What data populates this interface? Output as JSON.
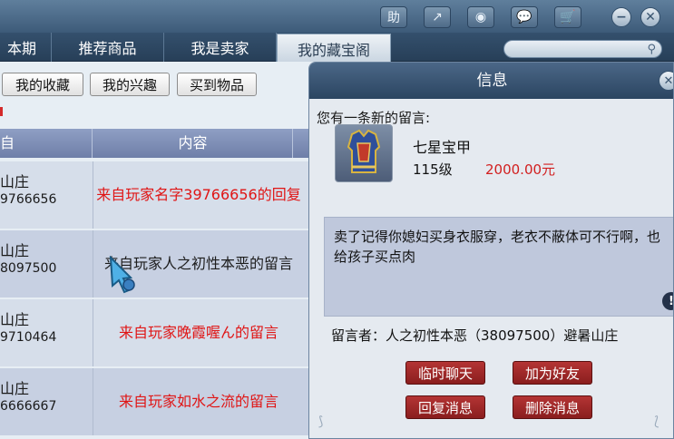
{
  "topbar": {
    "buttons": [
      {
        "icon": "help-icon",
        "glyph": "助"
      },
      {
        "icon": "share-icon",
        "glyph": "↗"
      },
      {
        "icon": "record-icon",
        "glyph": "◉"
      },
      {
        "icon": "chat-icon",
        "glyph": "💬"
      },
      {
        "icon": "cart-icon",
        "glyph": "🛒"
      }
    ],
    "minimize_glyph": "−",
    "close_glyph": "✕"
  },
  "tabs": [
    "本期",
    "推荐商品",
    "我是卖家",
    "我的藏宝阁"
  ],
  "active_tab": "我的藏宝阁",
  "search": {
    "placeholder": "",
    "icon": "search-icon",
    "glyph": "⚲"
  },
  "subtabs": [
    "我的收藏",
    "我的兴趣",
    "买到物品"
  ],
  "table": {
    "headers": [
      "自",
      "内容"
    ],
    "rows": [
      {
        "from_name": "山庄",
        "from_id": "9766656",
        "content": "来自玩家名字39766656的回复",
        "color": "red"
      },
      {
        "from_name": "山庄",
        "from_id": "8097500",
        "content": "来自玩家人之初性本恶的留言",
        "color": "dark"
      },
      {
        "from_name": "山庄",
        "from_id": "9710464",
        "content": "来自玩家晚霞喔ん的留言",
        "color": "red"
      },
      {
        "from_name": "山庄",
        "from_id": "6666667",
        "content": "来自玩家如水之流的留言",
        "color": "red"
      }
    ]
  },
  "dialog": {
    "title": "信息",
    "header": "您有一条新的留言:",
    "item": {
      "name": "七星宝甲",
      "level": "115级",
      "price": "2000.00元"
    },
    "message": "卖了记得你媳妇买身衣服穿，老衣不蔽体可不行啊，也给孩子买点肉",
    "sender": "留言者：人之初性本恶（38097500）避暑山庄",
    "buttons": [
      "临时聊天",
      "加为好友",
      "回复消息",
      "删除消息"
    ],
    "warning_glyph": "!",
    "close_glyph": "✕"
  },
  "colors": {
    "accent_red": "#e01515",
    "button_red": "#9a2424",
    "header_blue": "#34506d"
  }
}
